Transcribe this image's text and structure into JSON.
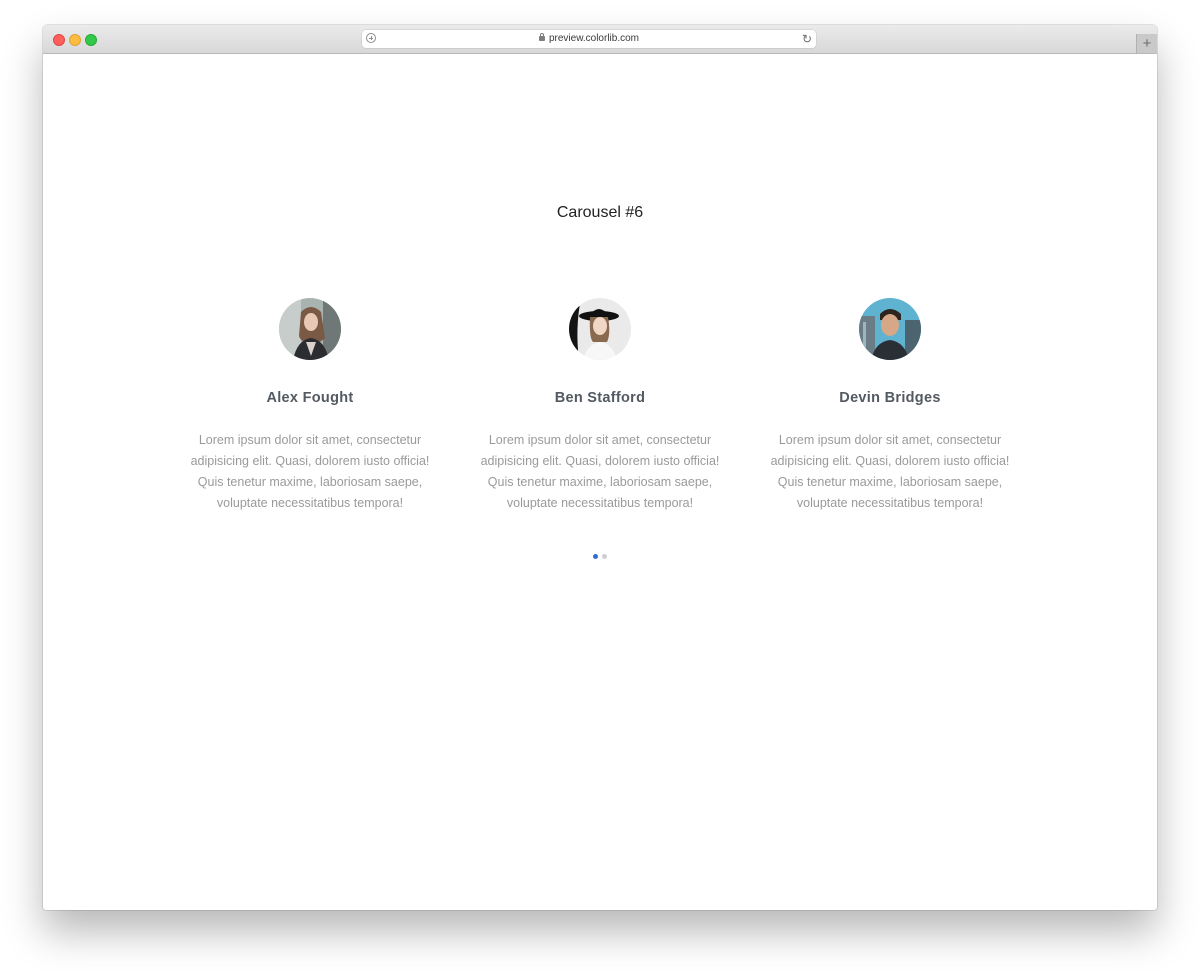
{
  "browser": {
    "url": "preview.colorlib.com",
    "new_tab_label": "+",
    "reload_label": "↻"
  },
  "page": {
    "title": "Carousel #6"
  },
  "carousel": {
    "items": [
      {
        "name": "Alex Fought",
        "text": "Lorem ipsum dolor sit amet, consectetur adipisicing elit. Quasi, dolorem iusto officia! Quis tenetur maxime, laboriosam saepe, voluptate necessitatibus tempora!",
        "avatar_icon": "woman-leather-jacket-photo"
      },
      {
        "name": "Ben Stafford",
        "text": "Lorem ipsum dolor sit amet, consectetur adipisicing elit. Quasi, dolorem iusto officia! Quis tenetur maxime, laboriosam saepe, voluptate necessitatibus tempora!",
        "avatar_icon": "woman-black-hat-photo"
      },
      {
        "name": "Devin Bridges",
        "text": "Lorem ipsum dolor sit amet, consectetur adipisicing elit. Quasi, dolorem iusto officia! Quis tenetur maxime, laboriosam saepe, voluptate necessitatibus tempora!",
        "avatar_icon": "man-portrait-photo"
      }
    ],
    "pagination": {
      "count": 2,
      "active_index": 0
    }
  },
  "colors": {
    "dot_active": "#2f6fd6",
    "dot_inactive": "#cfcfcf",
    "name_text": "#545a61",
    "body_text": "#9a9a9a"
  }
}
